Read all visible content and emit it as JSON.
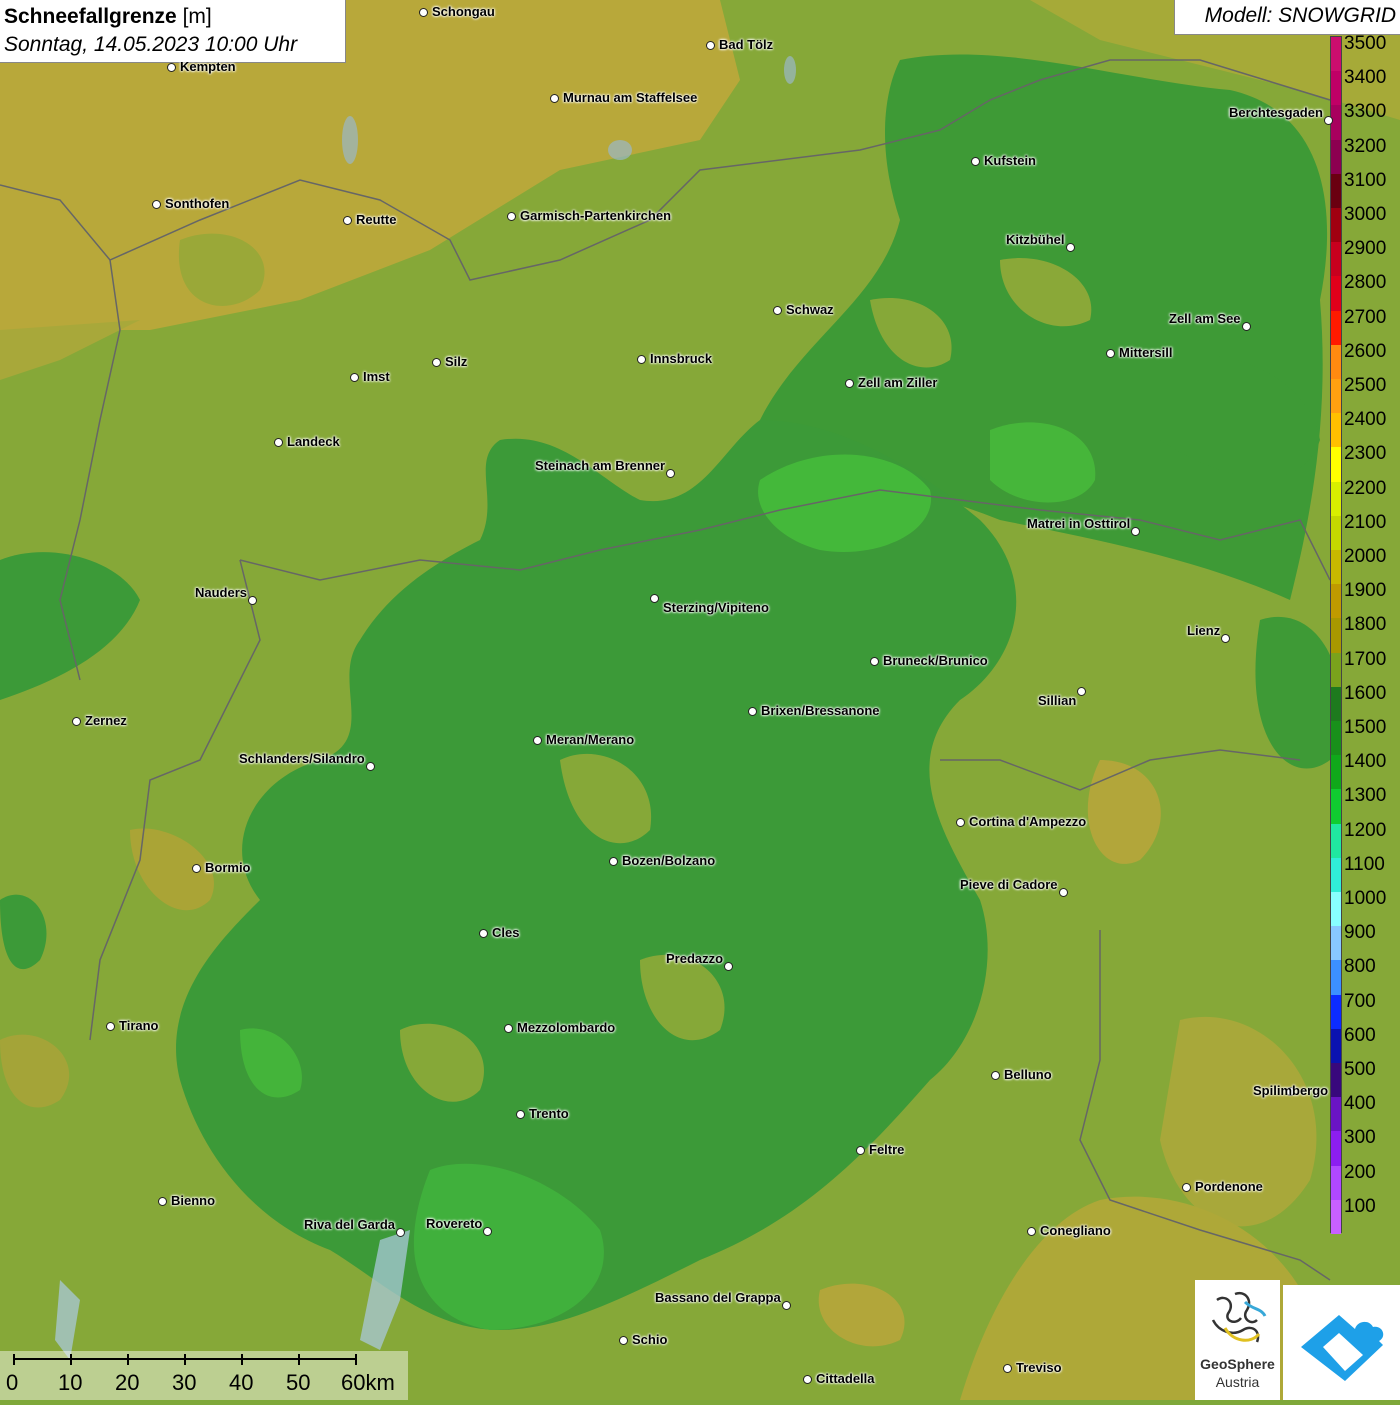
{
  "title": {
    "parameter": "Schneefallgrenze",
    "unit": "[m]",
    "datetime": "Sonntag, 14.05.2023 10:00 Uhr"
  },
  "model": "Modell: SNOWGRID",
  "legend": {
    "labels": [
      "3500",
      "3400",
      "3300",
      "3200",
      "3100",
      "3000",
      "2900",
      "2800",
      "2700",
      "2600",
      "2500",
      "2400",
      "2300",
      "2200",
      "2100",
      "2000",
      "1900",
      "1800",
      "1700",
      "1600",
      "1500",
      "1400",
      "1300",
      "1200",
      "1100",
      "1000",
      "900",
      "800",
      "700",
      "600",
      "500",
      "400",
      "300",
      "200",
      "100"
    ],
    "colors": [
      "#cc0d6e",
      "#c00066",
      "#a8005e",
      "#8c0050",
      "#6a0010",
      "#a00010",
      "#c8001e",
      "#e0001a",
      "#ff1a00",
      "#ff8a10",
      "#ffa010",
      "#ffc000",
      "#ffff00",
      "#d8ef00",
      "#c4d800",
      "#c8b800",
      "#c09a00",
      "#a89800",
      "#7aa21c",
      "#1e7a1e",
      "#18901a",
      "#10a81a",
      "#10cc30",
      "#20e8a0",
      "#30eed8",
      "#88ffff",
      "#88c8ff",
      "#3c90ff",
      "#0c2cff",
      "#0a12b0",
      "#38087c",
      "#6a14c4",
      "#8c1ef0",
      "#b048ff",
      "#c860ff"
    ]
  },
  "cities": [
    {
      "name": "Schongau"
    },
    {
      "name": "Kempten"
    },
    {
      "name": "Bad Tölz"
    },
    {
      "name": "Murnau am Staffelsee"
    },
    {
      "name": "Berchtesgaden"
    },
    {
      "name": "Kufstein"
    },
    {
      "name": "Sonthofen"
    },
    {
      "name": "Reutte"
    },
    {
      "name": "Garmisch-Partenkirchen"
    },
    {
      "name": "Kitzbühel"
    },
    {
      "name": "Schwaz"
    },
    {
      "name": "Zell am See"
    },
    {
      "name": "Mittersill"
    },
    {
      "name": "Innsbruck"
    },
    {
      "name": "Imst"
    },
    {
      "name": "Silz"
    },
    {
      "name": "Zell am Ziller"
    },
    {
      "name": "Landeck"
    },
    {
      "name": "Steinach am Brenner"
    },
    {
      "name": "Matrei in Osttirol"
    },
    {
      "name": "Nauders"
    },
    {
      "name": "Sterzing/Vipiteno"
    },
    {
      "name": "Lienz"
    },
    {
      "name": "Bruneck/Brunico"
    },
    {
      "name": "Sillian"
    },
    {
      "name": "Zernez"
    },
    {
      "name": "Brixen/Bressanone"
    },
    {
      "name": "Meran/Merano"
    },
    {
      "name": "Schlanders/Silandro"
    },
    {
      "name": "Cortina d'Ampezzo"
    },
    {
      "name": "Bozen/Bolzano"
    },
    {
      "name": "Bormio"
    },
    {
      "name": "Pieve di Cadore"
    },
    {
      "name": "Cles"
    },
    {
      "name": "Predazzo"
    },
    {
      "name": "Tirano"
    },
    {
      "name": "Mezzolombardo"
    },
    {
      "name": "Belluno"
    },
    {
      "name": "Spilimbergo"
    },
    {
      "name": "Trento"
    },
    {
      "name": "Feltre"
    },
    {
      "name": "Pordenone"
    },
    {
      "name": "Bienno"
    },
    {
      "name": "Riva del Garda"
    },
    {
      "name": "Rovereto"
    },
    {
      "name": "Conegliano"
    },
    {
      "name": "Bassano del Grappa"
    },
    {
      "name": "Schio"
    },
    {
      "name": "Treviso"
    },
    {
      "name": "Cittadella"
    }
  ],
  "scale_bar": {
    "labels": [
      "0",
      "10",
      "20",
      "30",
      "40",
      "50",
      "60km"
    ]
  },
  "logo": {
    "line1": "GeoSphere",
    "line2": "Austria"
  }
}
